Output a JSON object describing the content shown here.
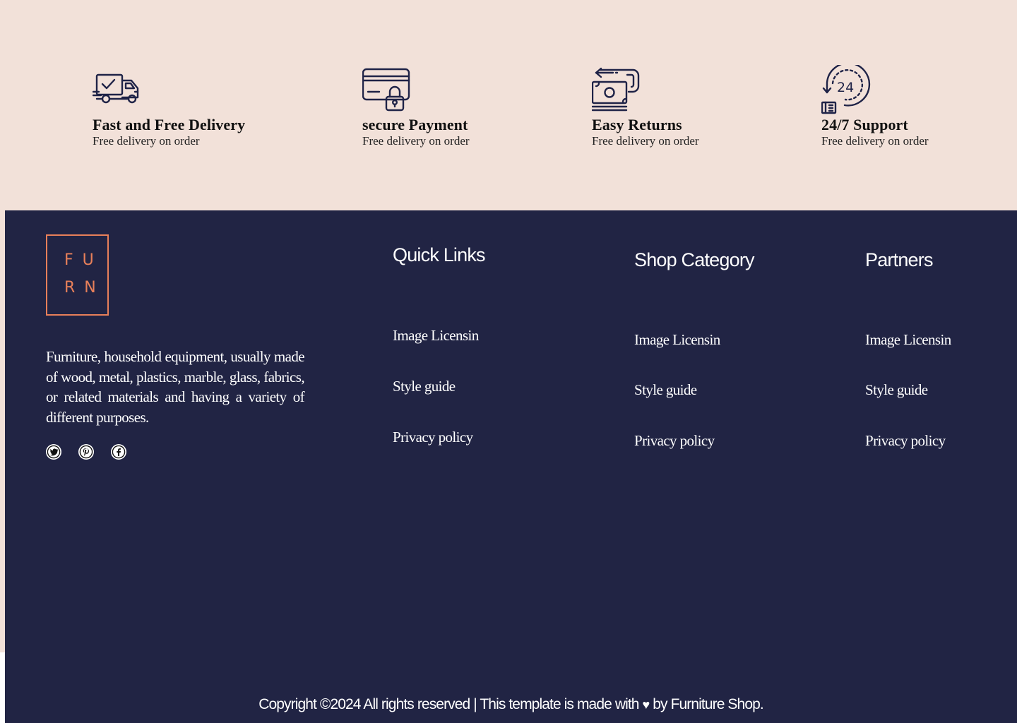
{
  "features": [
    {
      "title": "Fast and Free Delivery",
      "subtitle": "Free delivery on order",
      "icon": "delivery-truck-icon"
    },
    {
      "title": "secure Payment",
      "subtitle": "Free delivery on order",
      "icon": "secure-card-icon"
    },
    {
      "title": "Easy Returns",
      "subtitle": "Free delivery on order",
      "icon": "money-return-icon"
    },
    {
      "title": "24/7 Support",
      "subtitle": "Free delivery on order",
      "icon": "support-24-icon"
    }
  ],
  "logo": {
    "line1": "FU",
    "line2": "RN"
  },
  "about": "Furniture, household equipment, usually made of wood, metal, plastics, marble, glass, fabrics, or related materials and having a variety of different purposes.",
  "social": [
    "twitter-icon",
    "pinterest-icon",
    "facebook-icon"
  ],
  "columns": [
    {
      "title": "Quick Links",
      "links": [
        "Image Licensin",
        "Style guide",
        "Privacy policy"
      ]
    },
    {
      "title": "Shop Category",
      "links": [
        "Image Licensin",
        "Style guide",
        "Privacy policy"
      ]
    },
    {
      "title": "Partners",
      "links": [
        "Image Licensin",
        "Style guide",
        "Privacy policy"
      ]
    }
  ],
  "copyright": {
    "before": "Copyright ©2024 All rights reserved | This template is made with",
    "heart": "♥",
    "after": "by Furniture Shop."
  },
  "colors": {
    "band_bg": "#f2e1d9",
    "footer_bg": "#212444",
    "accent": "#e8805a",
    "icon_stroke": "#1f2347"
  }
}
